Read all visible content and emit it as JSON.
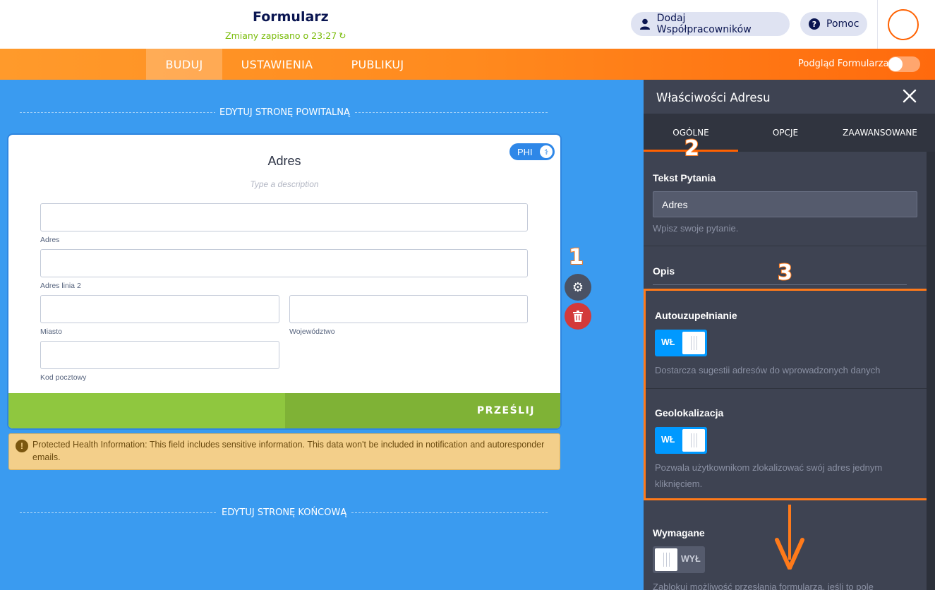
{
  "header": {
    "form_title": "Formularz",
    "saved_status": "Zmiany zapisano o 23:27",
    "collaborators_label": "Dodaj Współpracowników",
    "help_label": "Pomoc"
  },
  "nav": {
    "tabs": [
      {
        "label": "BUDUJ",
        "active": true
      },
      {
        "label": "USTAWIENIA",
        "active": false
      },
      {
        "label": "PUBLIKUJ",
        "active": false
      }
    ],
    "preview_label": "Podgląd Formularza",
    "preview_enabled": false
  },
  "canvas": {
    "welcome_link": "EDYTUJ STRONĘ POWITALNĄ",
    "thankyou_link": "EDYTUJ STRONĘ KOŃCOWĄ",
    "field": {
      "title": "Adres",
      "description_placeholder": "Type a description",
      "phi_badge": "PHI",
      "sublabels": {
        "address": "Adres",
        "address2": "Adres linia 2",
        "city": "Miasto",
        "state": "Województwo",
        "postal": "Kod pocztowy"
      }
    },
    "submit_label": "PRZEŚLIJ",
    "phi_warning": "Protected Health Information: This field includes sensitive information. This data won't be included in notification and autoresponder emails."
  },
  "annotations": {
    "step1": "1",
    "step2": "2",
    "step3": "3"
  },
  "panel": {
    "title": "Właściwości Adresu",
    "tabs": [
      "OGÓLNE",
      "OPCJE",
      "ZAAWANSOWANE"
    ],
    "active_tab": "OGÓLNE",
    "question_text_label": "Tekst Pytania",
    "question_text_value": "Adres",
    "question_text_help": "Wpisz swoje pytanie.",
    "description_label": "Opis",
    "autocomplete_label": "Autouzupełnianie",
    "autocomplete_state": "WŁ",
    "autocomplete_help": "Dostarcza sugestii adresów do wprowadzonych danych",
    "geolocation_label": "Geolokalizacja",
    "geolocation_state": "WŁ",
    "geolocation_help_line1": "Pozwala użytkownikom zlokalizować swój adres jednym",
    "geolocation_help_line2": "kliknięciem.",
    "required_label": "Wymagane",
    "required_state": "WYŁ",
    "required_help": "Zablokuj możliwość przesłania formularza, jeśli to pole"
  },
  "colors": {
    "accent_orange": "#ff6100",
    "canvas_blue": "#3a9bf0",
    "panel_dark": "#3e4352",
    "toggle_on": "#0099ff",
    "submit_green": "#8fc73f",
    "saved_green": "#78bb07"
  }
}
